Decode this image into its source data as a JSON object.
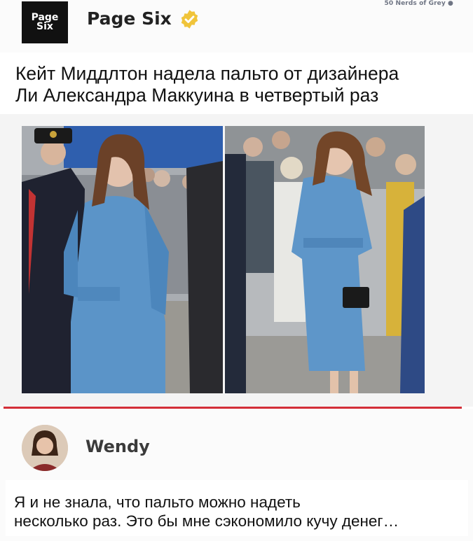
{
  "watermark": "50 Nerds of Grey ●",
  "post": {
    "logo_line1": "Page",
    "logo_line2": "Six",
    "account_name": "Page Six",
    "verified_icon": "verified-badge-icon",
    "verified_color": "#f0c43a",
    "headline_line1": "Кейт Миддлтон надела пальто от дизайнера",
    "headline_line2": "Ли Александра Маккуина в четвертый раз"
  },
  "accent_color": "#d32e37",
  "reply": {
    "name": "Wendy",
    "text_line1": "Я и не знала, что пальто можно надеть",
    "text_line2": "несколько раз. Это бы мне сэкономило кучу денег…"
  }
}
